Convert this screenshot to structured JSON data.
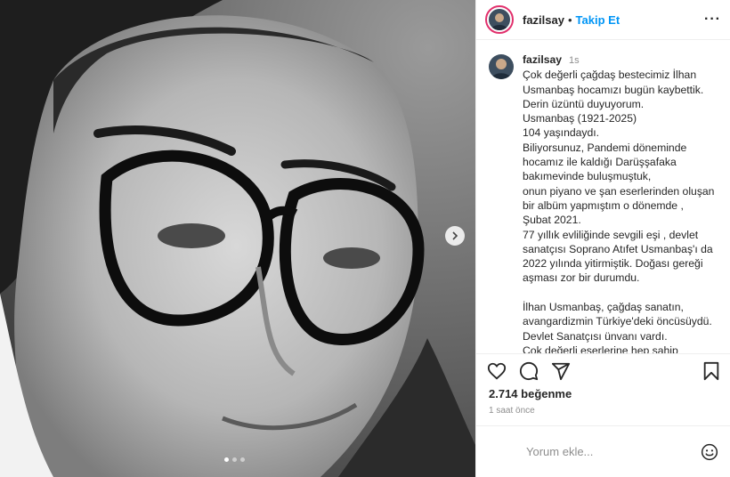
{
  "post": {
    "username": "fazilsay",
    "follow_label": "Takip Et",
    "separator": "•",
    "more_label": "···",
    "caption_time": "1s",
    "caption_lines": [
      "Çok değerli çağdaş bestecimiz İlhan",
      "Usmanbaş hocamızı bugün kaybettik.",
      "Derin üzüntü duyuyorum.",
      "Usmanbaş (1921-2025)",
      "104 yaşındaydı.",
      "Biliyorsunuz, Pandemi döneminde",
      "hocamız ile kaldığı Darüşşafaka",
      "bakımevinde buluşmuştuk,",
      "onun piyano ve şan eserlerinden oluşan",
      "bir albüm yapmıştım o dönemde ,",
      "Şubat 2021.",
      "77 yıllık evliliğinde sevgili eşi , devlet",
      "sanatçısı Soprano Atıfet Usmanbaş'ı da",
      "2022 yılında yitirmiştik. Doğası gereği",
      "aşması zor bir durumdu.",
      "",
      "İlhan Usmanbaş, çağdaş sanatın,",
      "avangardizmin Türkiye'deki öncüsüydü.",
      "Devlet Sanatçısı ünvanı vardı.",
      "Çok değerli eserlerine hep sahip"
    ],
    "likes": "2.714 beğenme",
    "time_ago": "1 saat önce",
    "comment_placeholder": "Yorum ekle...",
    "carousel": {
      "total": 3,
      "active": 1
    }
  },
  "icons": {
    "like": "heart-icon",
    "comment": "comment-icon",
    "share": "share-icon",
    "save": "bookmark-icon",
    "next": "chevron-right-icon",
    "emoji": "emoji-icon"
  },
  "colors": {
    "link": "#0095f6",
    "story_ring": "#e1306c",
    "muted": "#8e8e8e"
  }
}
